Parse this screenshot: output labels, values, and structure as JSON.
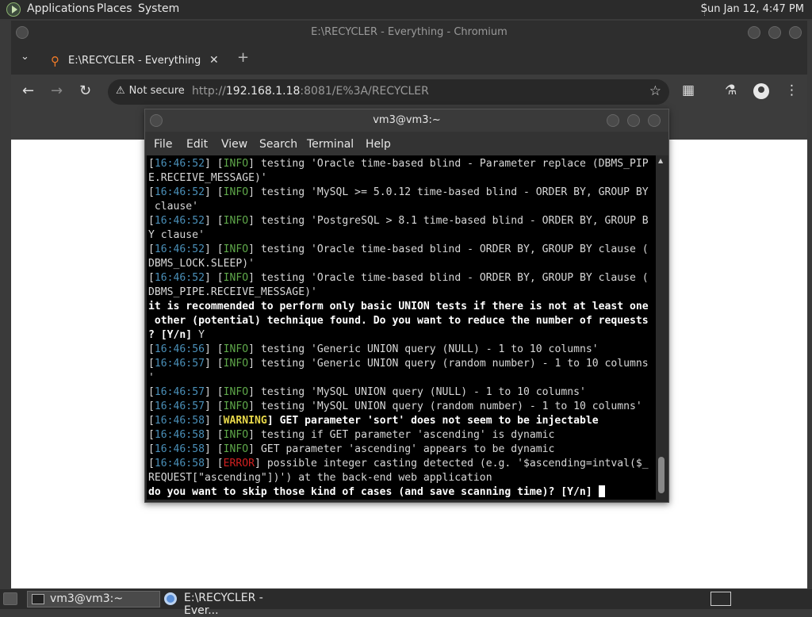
{
  "panel": {
    "menus": [
      "Applications",
      "Places",
      "System"
    ],
    "clock": "Sun Jan 12,  4:47 PM"
  },
  "browser": {
    "window_title": "E:\\RECYCLER - Everything - Chromium",
    "tab_title": "E:\\RECYCLER - Everything",
    "security_label": "Not secure",
    "url_prefix": "http://",
    "url_host": "192.168.1.18",
    "url_rest": ":8081/E%3A/RECYCLER"
  },
  "terminal": {
    "title": "vm3@vm3:~",
    "menu": [
      "File",
      "Edit",
      "View",
      "Search",
      "Terminal",
      "Help"
    ],
    "lines": [
      [
        {
          "t": "[",
          "c": "tb"
        },
        {
          "t": "16:46:52",
          "c": "ts"
        },
        {
          "t": "] [",
          "c": "tb"
        },
        {
          "t": "INFO",
          "c": "ti"
        },
        {
          "t": "] testing 'Oracle time-based blind - Parameter replace (DBMS_PIP",
          "c": "tb"
        }
      ],
      [
        {
          "t": "E.RECEIVE_MESSAGE)'",
          "c": "tb"
        }
      ],
      [
        {
          "t": "[",
          "c": "tb"
        },
        {
          "t": "16:46:52",
          "c": "ts"
        },
        {
          "t": "] [",
          "c": "tb"
        },
        {
          "t": "INFO",
          "c": "ti"
        },
        {
          "t": "] testing 'MySQL >= 5.0.12 time-based blind - ORDER BY, GROUP BY",
          "c": "tb"
        }
      ],
      [
        {
          "t": " clause'",
          "c": "tb"
        }
      ],
      [
        {
          "t": "[",
          "c": "tb"
        },
        {
          "t": "16:46:52",
          "c": "ts"
        },
        {
          "t": "] [",
          "c": "tb"
        },
        {
          "t": "INFO",
          "c": "ti"
        },
        {
          "t": "] testing 'PostgreSQL > 8.1 time-based blind - ORDER BY, GROUP B",
          "c": "tb"
        }
      ],
      [
        {
          "t": "Y clause'",
          "c": "tb"
        }
      ],
      [
        {
          "t": "[",
          "c": "tb"
        },
        {
          "t": "16:46:52",
          "c": "ts"
        },
        {
          "t": "] [",
          "c": "tb"
        },
        {
          "t": "INFO",
          "c": "ti"
        },
        {
          "t": "] testing 'Oracle time-based blind - ORDER BY, GROUP BY clause (",
          "c": "tb"
        }
      ],
      [
        {
          "t": "DBMS_LOCK.SLEEP)'",
          "c": "tb"
        }
      ],
      [
        {
          "t": "[",
          "c": "tb"
        },
        {
          "t": "16:46:52",
          "c": "ts"
        },
        {
          "t": "] [",
          "c": "tb"
        },
        {
          "t": "INFO",
          "c": "ti"
        },
        {
          "t": "] testing 'Oracle time-based blind - ORDER BY, GROUP BY clause (",
          "c": "tb"
        }
      ],
      [
        {
          "t": "DBMS_PIPE.RECEIVE_MESSAGE)'",
          "c": "tb"
        }
      ],
      [
        {
          "t": "it is recommended to perform only basic UNION tests if there is not at least one",
          "c": "bold"
        }
      ],
      [
        {
          "t": " other (potential) technique found. Do you want to reduce the number of requests",
          "c": "bold"
        }
      ],
      [
        {
          "t": "? [Y/n] ",
          "c": "bold"
        },
        {
          "t": "Y",
          "c": "tb"
        }
      ],
      [
        {
          "t": "[",
          "c": "tb"
        },
        {
          "t": "16:46:56",
          "c": "ts"
        },
        {
          "t": "] [",
          "c": "tb"
        },
        {
          "t": "INFO",
          "c": "ti"
        },
        {
          "t": "] testing 'Generic UNION query (NULL) - 1 to 10 columns'",
          "c": "tb"
        }
      ],
      [
        {
          "t": "[",
          "c": "tb"
        },
        {
          "t": "16:46:57",
          "c": "ts"
        },
        {
          "t": "] [",
          "c": "tb"
        },
        {
          "t": "INFO",
          "c": "ti"
        },
        {
          "t": "] testing 'Generic UNION query (random number) - 1 to 10 columns",
          "c": "tb"
        }
      ],
      [
        {
          "t": "'",
          "c": "tb"
        }
      ],
      [
        {
          "t": "[",
          "c": "tb"
        },
        {
          "t": "16:46:57",
          "c": "ts"
        },
        {
          "t": "] [",
          "c": "tb"
        },
        {
          "t": "INFO",
          "c": "ti"
        },
        {
          "t": "] testing 'MySQL UNION query (NULL) - 1 to 10 columns'",
          "c": "tb"
        }
      ],
      [
        {
          "t": "[",
          "c": "tb"
        },
        {
          "t": "16:46:57",
          "c": "ts"
        },
        {
          "t": "] [",
          "c": "tb"
        },
        {
          "t": "INFO",
          "c": "ti"
        },
        {
          "t": "] testing 'MySQL UNION query (random number) - 1 to 10 columns'",
          "c": "tb"
        }
      ],
      [
        {
          "t": "[",
          "c": "tb"
        },
        {
          "t": "16:46:58",
          "c": "ts"
        },
        {
          "t": "] [",
          "c": "tb"
        },
        {
          "t": "WARNING",
          "c": "tw"
        },
        {
          "t": "] GET parameter 'sort' does not seem to be injectable",
          "c": "bold"
        }
      ],
      [
        {
          "t": "[",
          "c": "tb"
        },
        {
          "t": "16:46:58",
          "c": "ts"
        },
        {
          "t": "] [",
          "c": "tb"
        },
        {
          "t": "INFO",
          "c": "ti"
        },
        {
          "t": "] testing if GET parameter 'ascending' is dynamic",
          "c": "tb"
        }
      ],
      [
        {
          "t": "[",
          "c": "tb"
        },
        {
          "t": "16:46:58",
          "c": "ts"
        },
        {
          "t": "] [",
          "c": "tb"
        },
        {
          "t": "INFO",
          "c": "ti"
        },
        {
          "t": "] GET parameter 'ascending' appears to be dynamic",
          "c": "tb"
        }
      ],
      [
        {
          "t": "[",
          "c": "tb"
        },
        {
          "t": "16:46:58",
          "c": "ts"
        },
        {
          "t": "] [",
          "c": "tb"
        },
        {
          "t": "ERROR",
          "c": "te"
        },
        {
          "t": "] possible integer casting detected (e.g. '$ascending=intval($_",
          "c": "tb"
        }
      ],
      [
        {
          "t": "REQUEST[\"ascending\"])') at the back-end web application",
          "c": "tb"
        }
      ],
      [
        {
          "t": "do you want to skip those kind of cases (and save scanning time)? [Y/n] ",
          "c": "bold"
        }
      ]
    ]
  },
  "taskbar": {
    "items": [
      "vm3@vm3:~",
      "E:\\RECYCLER - Ever..."
    ]
  }
}
